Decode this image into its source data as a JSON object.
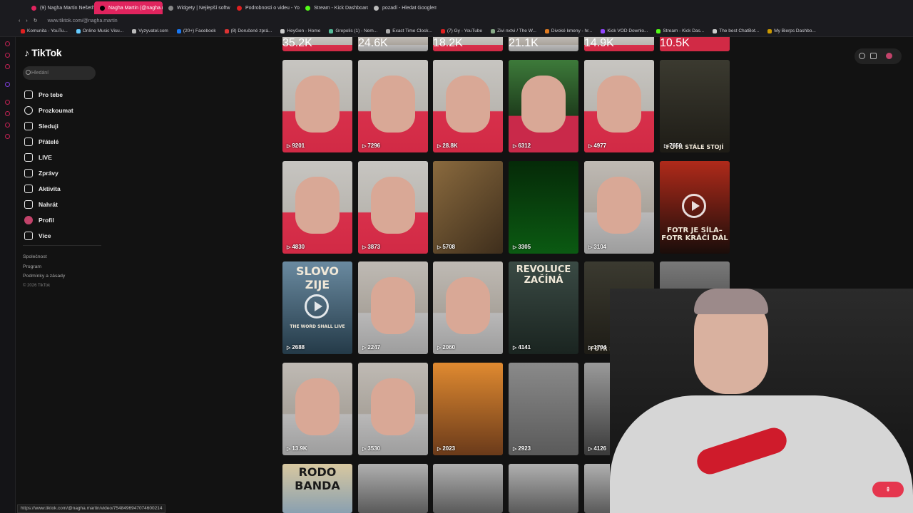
{
  "tabs": [
    {
      "label": "(9) Nagha Martin Nešetří",
      "color": "#e0245e"
    },
    {
      "label": "Nagha Martin (@nagha.m",
      "color": "#000",
      "active": true
    },
    {
      "label": "Widgety | Nejlepší softw",
      "color": "#888"
    },
    {
      "label": "Podrobnosti o videu - You",
      "color": "#e02020"
    },
    {
      "label": "Stream - Kick Dashboard",
      "color": "#53fc18"
    },
    {
      "label": "pozadí - Hledat Googlem",
      "color": "#bbb"
    }
  ],
  "address": "www.tiktok.com/@nagha.martin",
  "bookmarks": [
    "Komunita - YouTu...",
    "Online Music Visu...",
    "Vyzyvatel.com",
    "(20+) Facebook",
    "(8) Doručené zprá...",
    "HeyGen - Home",
    "Grepolis (1) - Nem...",
    "Exact Time Clock...",
    "(7) Gy - YouTube",
    "Zivi nxtvi / The W...",
    "Divoké kmeny - hr...",
    "Kick VOD Downlo...",
    "Stream - Kick Das...",
    "The best ChatBot...",
    "My Bierps Dashbo..."
  ],
  "sidebar": {
    "logo": "TikTok",
    "search_placeholder": "Hledání",
    "items": [
      {
        "label": "Pro tebe",
        "icon": "home-icon"
      },
      {
        "label": "Prozkoumat",
        "icon": "compass-icon"
      },
      {
        "label": "Sleduji",
        "icon": "person-icon"
      },
      {
        "label": "Přátelé",
        "icon": "friends-icon"
      },
      {
        "label": "LIVE",
        "icon": "live-icon"
      },
      {
        "label": "Zprávy",
        "icon": "messages-icon"
      },
      {
        "label": "Aktivita",
        "icon": "activity-icon"
      },
      {
        "label": "Nahrát",
        "icon": "upload-icon"
      },
      {
        "label": "Profil",
        "icon": "avatar-icon"
      },
      {
        "label": "Více",
        "icon": "more-icon"
      }
    ],
    "footer": [
      "Společnost",
      "Program",
      "Podmínky a zásady"
    ],
    "copyright": "© 2026 TikTok"
  },
  "top_row_views": [
    "35.2K",
    "24.6K",
    "18.2K",
    "21.1K",
    "14.9K",
    "10.5K"
  ],
  "rows": [
    [
      "9201",
      "7296",
      "28.8K",
      "6312",
      "4977",
      "7650"
    ],
    [
      "4830",
      "3873",
      "5708",
      "3305",
      "3104",
      ""
    ],
    [
      "2688",
      "2247",
      "2060",
      "4141",
      "1704",
      "1659"
    ],
    [
      "13.9K",
      "3530",
      "2023",
      "2923",
      "4126",
      ""
    ]
  ],
  "posters": {
    "fotr_je_sila": "FOTR JE SÍLA– FOTR KRÁČÍ DÁL",
    "slovo_zije": "SLOVO ZIJE",
    "word_live": "THE WORD SHALL LIVE",
    "revoluce": "REVOLUCE ZAČÍNÁ",
    "rodo_banda": "RODO BANDA",
    "fotr_stale": "FOTR STÁLE STOJÍ",
    "nagha": "NAGHA WAKAN"
  },
  "status_url": "https://www.tiktok.com/@nagha.martin/video/7548496947074600214",
  "colors": {
    "accent": "#e0245e",
    "bg": "#121212"
  }
}
